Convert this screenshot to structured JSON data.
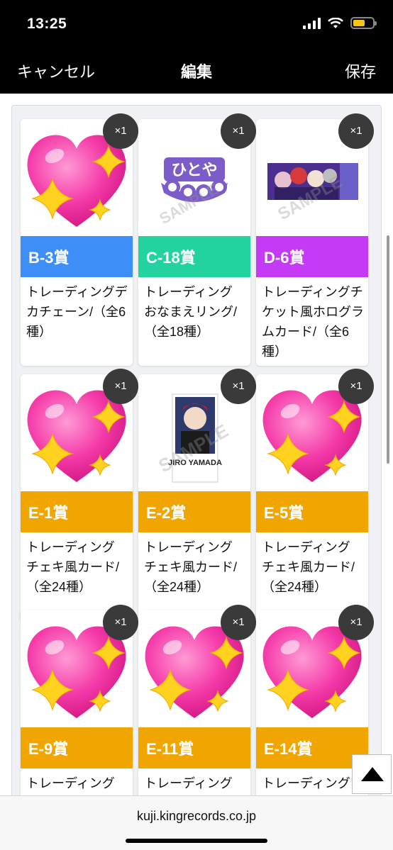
{
  "status_bar": {
    "time": "13:25",
    "battery_color": "#f5c518"
  },
  "nav": {
    "cancel": "キャンセル",
    "title": "編集",
    "save": "保存"
  },
  "cards": [
    {
      "band": "B-3賞",
      "band_color": "#3d8ff7",
      "qty": "×1",
      "desc": "トレーディングデカチェーン/（全6種）",
      "image": "heart-emoji"
    },
    {
      "band": "C-18賞",
      "band_color": "#22d3a0",
      "qty": "×1",
      "desc": "トレーディング おなまえリング/（全18種）",
      "image": "name-ring",
      "image_text": "ひとや"
    },
    {
      "band": "D-6賞",
      "band_color": "#c53af5",
      "qty": "×1",
      "desc": "トレーディングチケット風ホログラムカード/（全6種）",
      "image": "ticket-card"
    },
    {
      "band": "E-1賞",
      "band_color": "#f0a500",
      "qty": "×1",
      "desc": "トレーディング チェキ風カード/（全24種）",
      "image": "heart-emoji"
    },
    {
      "band": "E-2賞",
      "band_color": "#f0a500",
      "qty": "×1",
      "desc": "トレーディング チェキ風カード/（全24種）",
      "image": "cheki-card",
      "image_text": "JIRO YAMADA"
    },
    {
      "band": "E-5賞",
      "band_color": "#f0a500",
      "qty": "×1",
      "desc": "トレーディング チェキ風カード/（全24種）",
      "image": "heart-emoji"
    },
    {
      "band": "E-9賞",
      "band_color": "#f0a500",
      "qty": "×1",
      "desc": "トレーディング チ",
      "image": "heart-emoji"
    },
    {
      "band": "E-11賞",
      "band_color": "#f0a500",
      "qty": "×1",
      "desc": "トレーディング チ",
      "image": "heart-emoji"
    },
    {
      "band": "E-14賞",
      "band_color": "#f0a500",
      "qty": "×1",
      "desc": "トレーディング チ",
      "image": "heart-emoji"
    }
  ],
  "watermark": "SAMPLE",
  "url_bar": {
    "url": "kuji.kingrecords.co.jp"
  },
  "page_top_icon": "triangle-up-icon"
}
